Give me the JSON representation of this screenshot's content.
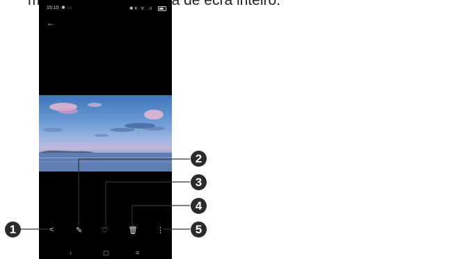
{
  "caption": "mesma a partir da vista de ecrã inteiro.",
  "status_bar": {
    "time": "15:10"
  },
  "toolbar": {
    "share_icon": "share-icon",
    "edit_icon": "pencil-icon",
    "favorite_icon": "heart-icon",
    "delete_icon": "trash-icon",
    "more_icon": "more-vert-icon"
  },
  "nav": {
    "back": "‹",
    "home": "▢",
    "recents": "≡"
  },
  "callouts": [
    "1",
    "2",
    "3",
    "4",
    "5"
  ]
}
